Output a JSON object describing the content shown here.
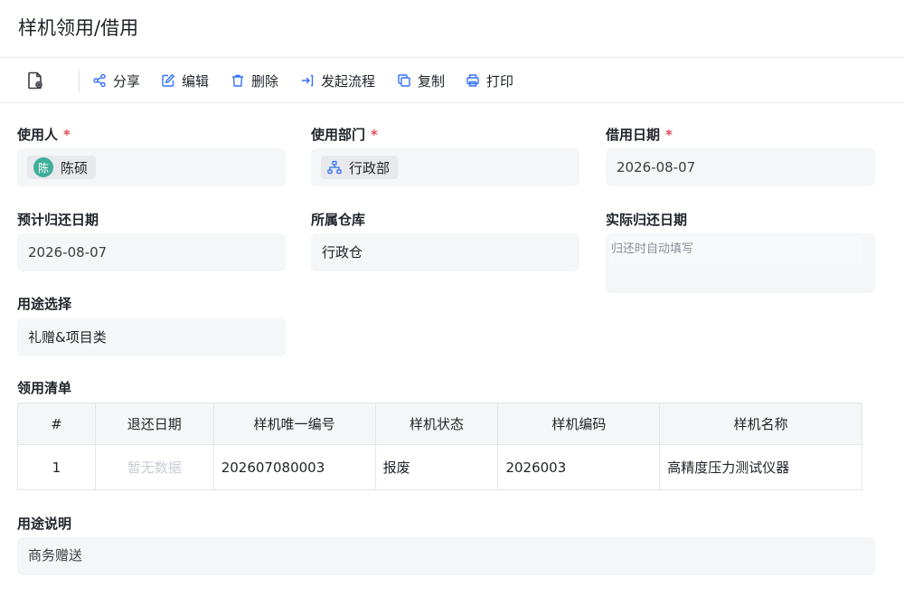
{
  "page": {
    "title": "样机领用/借用"
  },
  "toolbar": {
    "doc_icon": "document-view-icon",
    "share": "分享",
    "edit": "编辑",
    "delete": "删除",
    "start_flow": "发起流程",
    "copy": "复制",
    "print": "打印"
  },
  "form": {
    "user": {
      "label": "使用人",
      "required_mark": "*",
      "avatar_text": "陈",
      "value": "陈硕",
      "avatar_color": "#3fae9a"
    },
    "department": {
      "label": "使用部门",
      "required_mark": "*",
      "value": "行政部"
    },
    "borrow_date": {
      "label": "借用日期",
      "required_mark": "*",
      "value": "2026-08-07"
    },
    "planned_return_date": {
      "label": "预计归还日期",
      "value": "2026-08-07"
    },
    "warehouse": {
      "label": "所属仓库",
      "value": "行政仓"
    },
    "actual_return_date": {
      "label": "实际归还日期",
      "placeholder": "归还时自动填写"
    },
    "purpose_select": {
      "label": "用途选择",
      "value": "礼赠&项目类"
    },
    "purpose_desc": {
      "label": "用途说明",
      "value": "商务赠送"
    }
  },
  "list": {
    "title": "领用清单",
    "headers": [
      "#",
      "退还日期",
      "样机唯一编号",
      "样机状态",
      "样机编码",
      "样机名称"
    ],
    "rows": [
      {
        "index": "1",
        "return_date": "暂无数据",
        "unique_no": "202607080003",
        "status": "报废",
        "code": "2026003",
        "name": "高精度压力测试仪器"
      }
    ]
  },
  "colors": {
    "accent": "#3370ff",
    "required": "#e34d59",
    "field_bg": "#f5f6f7"
  }
}
